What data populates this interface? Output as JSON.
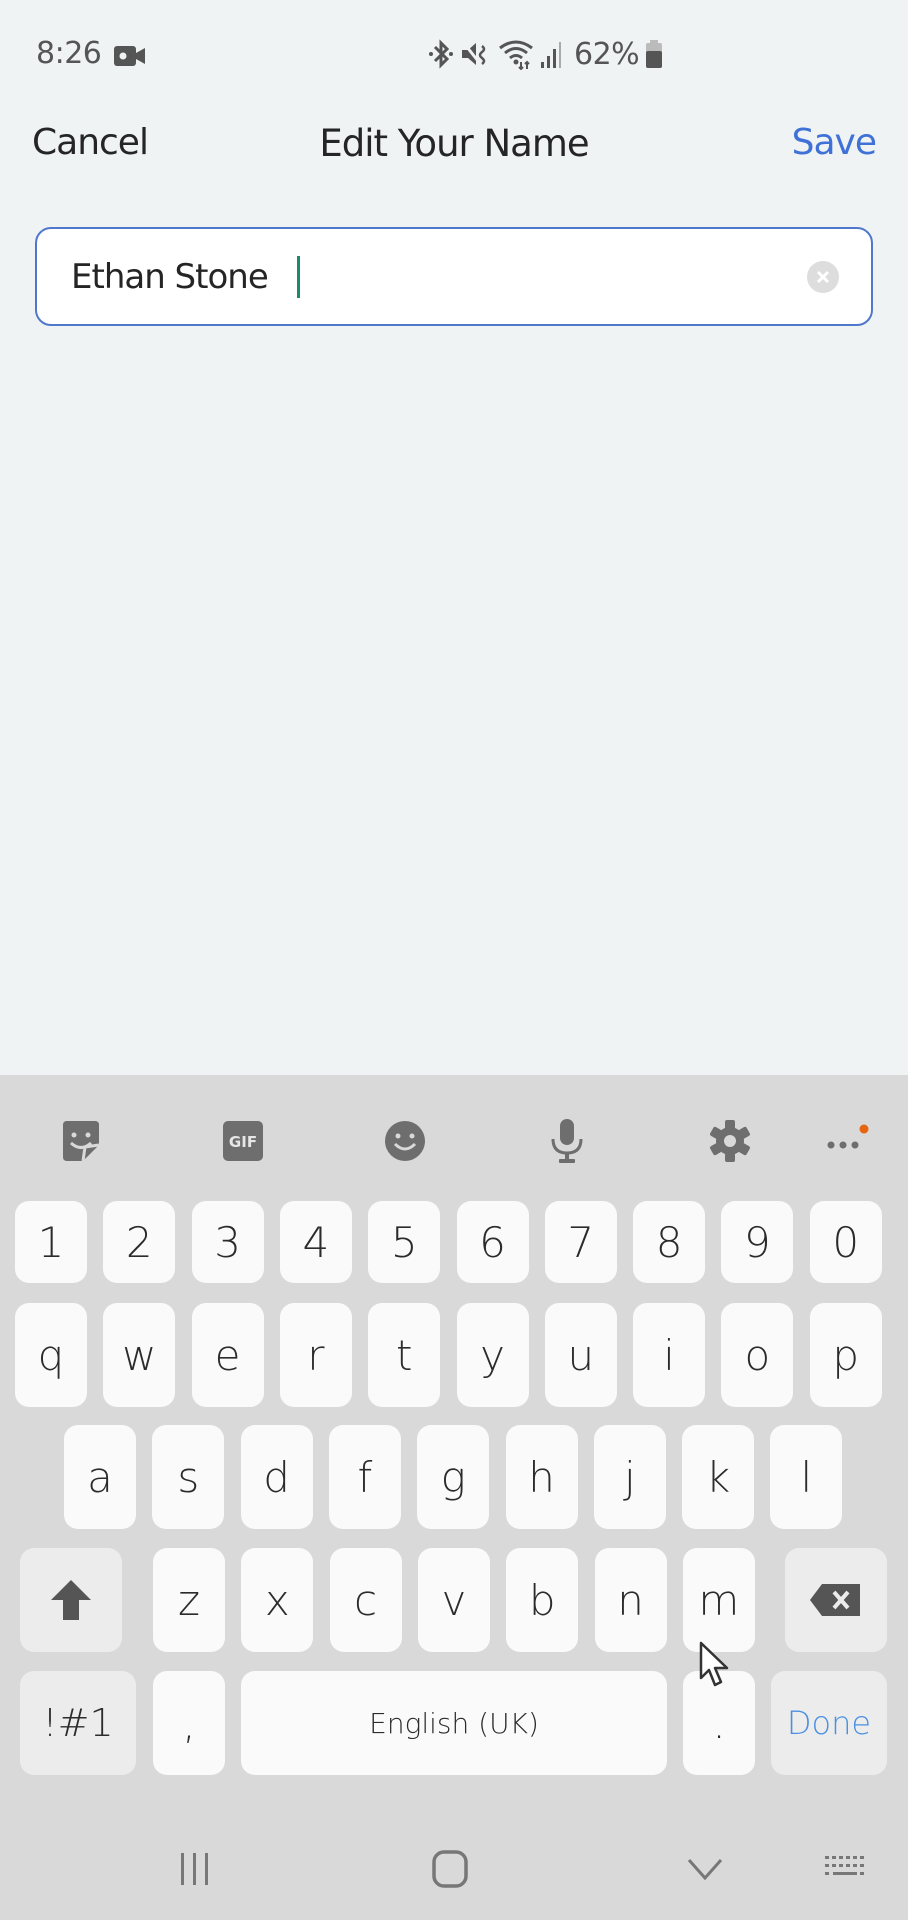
{
  "status_bar": {
    "time": "8:26",
    "left_icons": [
      "screen-record-icon"
    ],
    "right_icons": [
      "bluetooth-icon",
      "mute-icon",
      "wifi-icon",
      "signal-icon",
      "battery-icon"
    ],
    "battery_percent": "62%"
  },
  "header": {
    "cancel_label": "Cancel",
    "title": "Edit Your Name",
    "save_label": "Save"
  },
  "name_field": {
    "value": "Ethan Stone",
    "clear_icon": "clear-icon"
  },
  "keyboard": {
    "toolbar": [
      {
        "name": "sticker-icon"
      },
      {
        "name": "gif-icon",
        "label": "GIF"
      },
      {
        "name": "emoji-icon"
      },
      {
        "name": "microphone-icon"
      },
      {
        "name": "settings-icon"
      },
      {
        "name": "more-icon",
        "has_notification_dot": true
      }
    ],
    "number_row": [
      "1",
      "2",
      "3",
      "4",
      "5",
      "6",
      "7",
      "8",
      "9",
      "0"
    ],
    "row1": [
      "q",
      "w",
      "e",
      "r",
      "t",
      "y",
      "u",
      "i",
      "o",
      "p"
    ],
    "row2": [
      "a",
      "s",
      "d",
      "f",
      "g",
      "h",
      "j",
      "k",
      "l"
    ],
    "row3": [
      "z",
      "x",
      "c",
      "v",
      "b",
      "n",
      "m"
    ],
    "shift_icon": "shift-icon",
    "backspace_icon": "backspace-icon",
    "symbols_label": "!#1",
    "comma_label": ",",
    "space_label": "English (UK)",
    "period_label": ".",
    "done_label": "Done"
  },
  "nav_bar": {
    "buttons": [
      "recents-icon",
      "home-icon",
      "hide-keyboard-icon",
      "keyboard-switch-icon"
    ]
  },
  "colors": {
    "accent_blue": "#3f71d6",
    "done_blue": "#4a90e2",
    "caret_green": "#1a8a6c",
    "notification_orange": "#e8650f"
  }
}
